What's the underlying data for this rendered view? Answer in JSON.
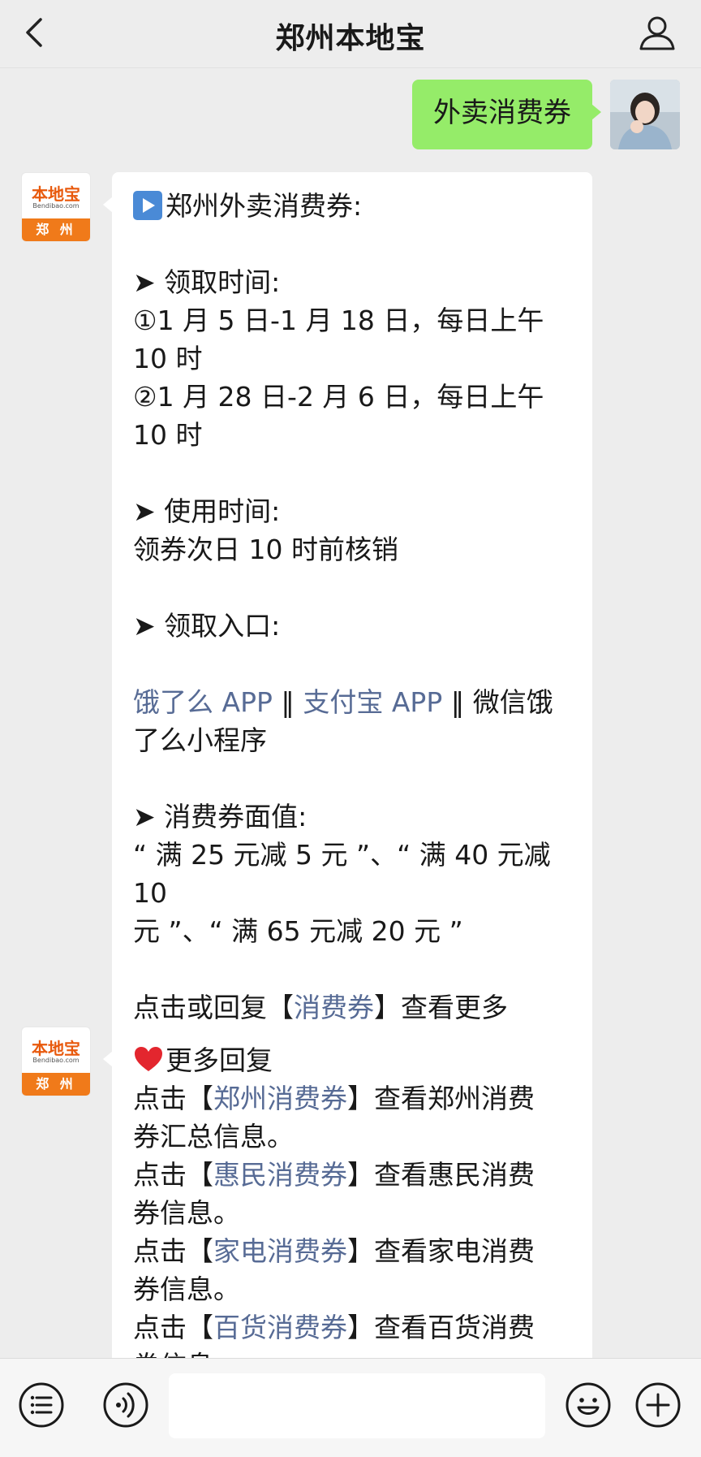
{
  "header": {
    "title": "郑州本地宝"
  },
  "messages": {
    "outgoing": {
      "text": "外卖消费券"
    },
    "bot": {
      "logo_brand": "本地宝",
      "logo_domain": "Bendibao.com",
      "logo_city": "郑 州"
    },
    "reply1": {
      "heading": "郑州外卖消费券:",
      "sec1_title": "➤ 领取时间:",
      "sec1_line1": "①1 月 5 日-1 月 18 日，每日上午",
      "sec1_line2": "10 时",
      "sec1_line3": "②1 月 28 日-2 月 6 日，每日上午",
      "sec1_line4": "10 时",
      "sec2_title": "➤ 使用时间:",
      "sec2_line1": "领券次日 10 时前核销",
      "sec3_title": "➤ 领取入口:",
      "entry_link1": "饿了么 APP",
      "entry_sep1": " ‖ ",
      "entry_link2": "支付宝 APP",
      "entry_sep2": " ‖ ",
      "entry_tail1": "微信饿",
      "entry_tail2": "了么小程序",
      "sec4_title": "➤ 消费券面值:",
      "sec4_line1": "“ 满 25 元减 5 元 ”、“ 满 40 元减 10",
      "sec4_line2": "元 ”、“ 满 65 元减 20 元 ”",
      "footer_pre": "点击或回复【",
      "footer_link": "消费券",
      "footer_post": "】查看更多"
    },
    "reply2": {
      "heading": "更多回复",
      "items": [
        {
          "pre": "点击【",
          "link": "郑州消费券",
          "post": "】查看郑州消费",
          "cont": "券汇总信息。"
        },
        {
          "pre": "点击【",
          "link": "惠民消费券",
          "post": "】查看惠民消费",
          "cont": "券信息。"
        },
        {
          "pre": "点击【",
          "link": "家电消费券",
          "post": "】查看家电消费",
          "cont": "券信息。"
        },
        {
          "pre": "点击【",
          "link": "百货消费券",
          "post": "】查看百货消费",
          "cont": "券信息。"
        }
      ]
    }
  },
  "colors": {
    "bubble_out": "#95ec69",
    "link": "#576b95",
    "background": "#ededed"
  }
}
